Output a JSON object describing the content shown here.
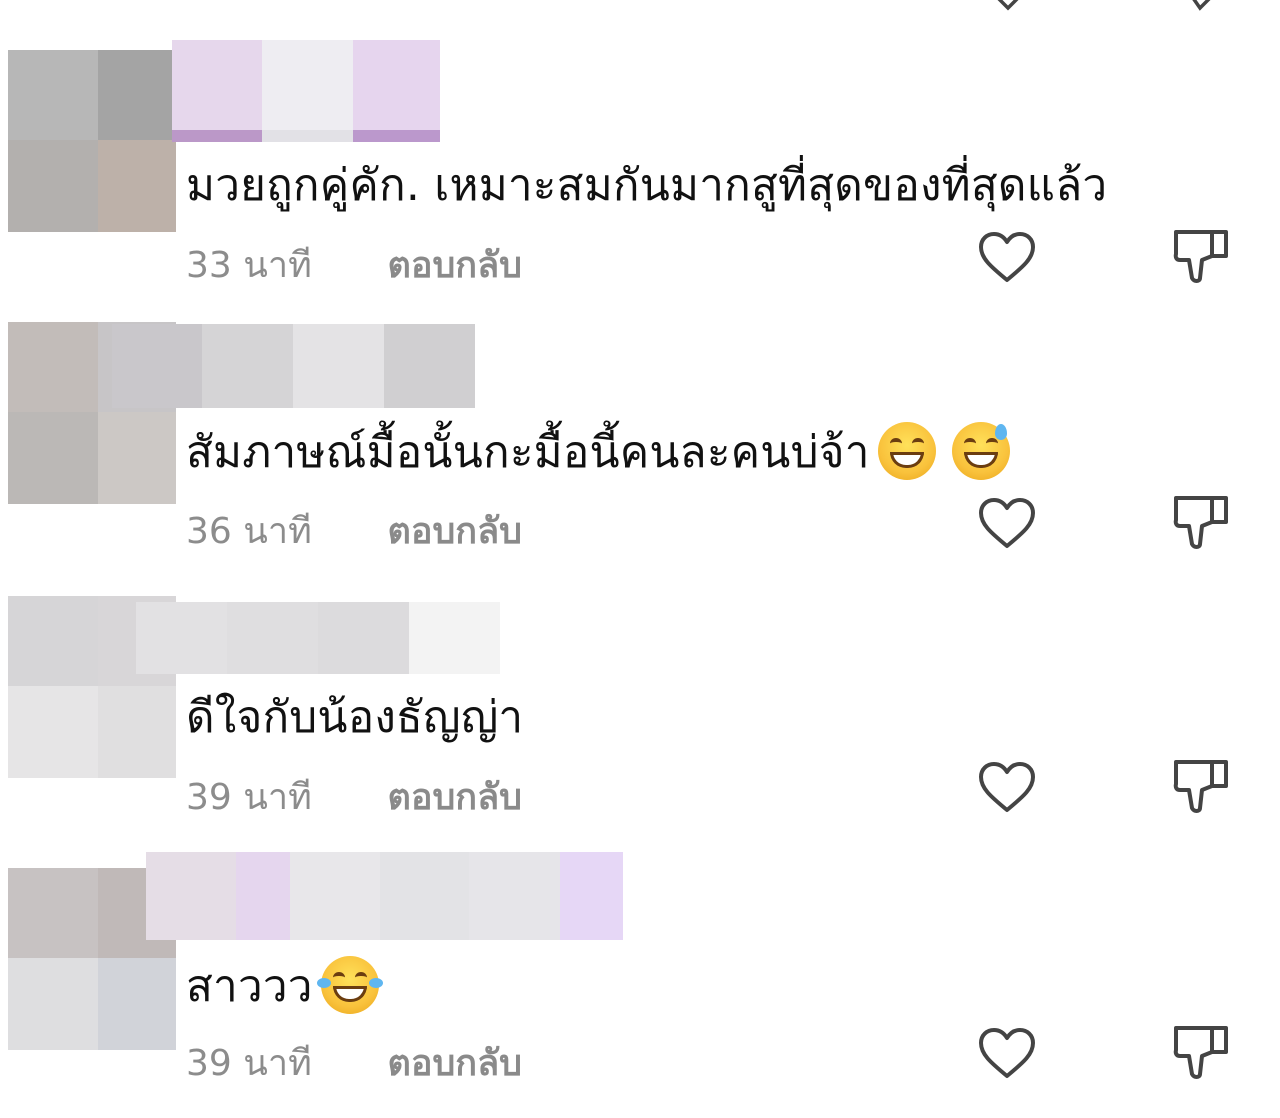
{
  "comments": [
    {
      "text": "มวยถูกคู่คัก. เหมาะสมกันมากสูที่สุดของที่สุดแล้ว",
      "emojis": [],
      "time": "33 นาที",
      "reply_label": "ตอบกลับ",
      "avatar_colors": [
        "#b7b7b7",
        "#a4a4a4",
        "#b3b0ae",
        "#bdb1a9"
      ],
      "name_colors": [
        "#e6d7ec",
        "#eeedf2",
        "#e6d5ee"
      ]
    },
    {
      "text": "สัมภาษณ์มื้อนั้นกะมื้อนี้คนละคนบ่จ้า",
      "emojis": [
        "grinning-face-emoji",
        "grinning-face-with-sweat-emoji"
      ],
      "time": "36 นาที",
      "reply_label": "ตอบกลับ",
      "avatar_colors": [
        "#c2bcb9",
        "#c7c5c7",
        "#bbb8b6",
        "#ccc8c5"
      ],
      "name_colors": [
        "#c9c7cb",
        "#d5d4d6",
        "#e4e3e5",
        "#d0cfd1"
      ]
    },
    {
      "text": "ดีใจกับน้องธัญญ่า",
      "emojis": [],
      "time": "39 นาที",
      "reply_label": "ตอบกลับ",
      "avatar_colors": [
        "#d6d5d7",
        "#d8d6d8",
        "#e6e5e6",
        "#e0dfe0"
      ],
      "name_colors": [
        "#e2e1e3",
        "#dfdee0",
        "#dcdbdd",
        "#f3f3f3"
      ]
    },
    {
      "text": "สาววว",
      "emojis": [
        "face-with-tears-of-joy-emoji"
      ],
      "time": "39 นาที",
      "reply_label": "ตอบกลับ",
      "avatar_colors": [
        "#c7c2c2",
        "#c0b9b8",
        "#dedee0",
        "#d1d3d9"
      ],
      "name_colors": [
        "#e5dde6",
        "#e5d6ee",
        "#e8e7ea",
        "#e3e3e6",
        "#e6e5e9",
        "#e6d7f6"
      ]
    }
  ],
  "icons": {
    "like": "heart-outline-icon",
    "dislike": "thumbs-down-outline-icon"
  },
  "colors": {
    "text": "#111111",
    "meta": "#8c8c8c",
    "icon": "#444444"
  }
}
